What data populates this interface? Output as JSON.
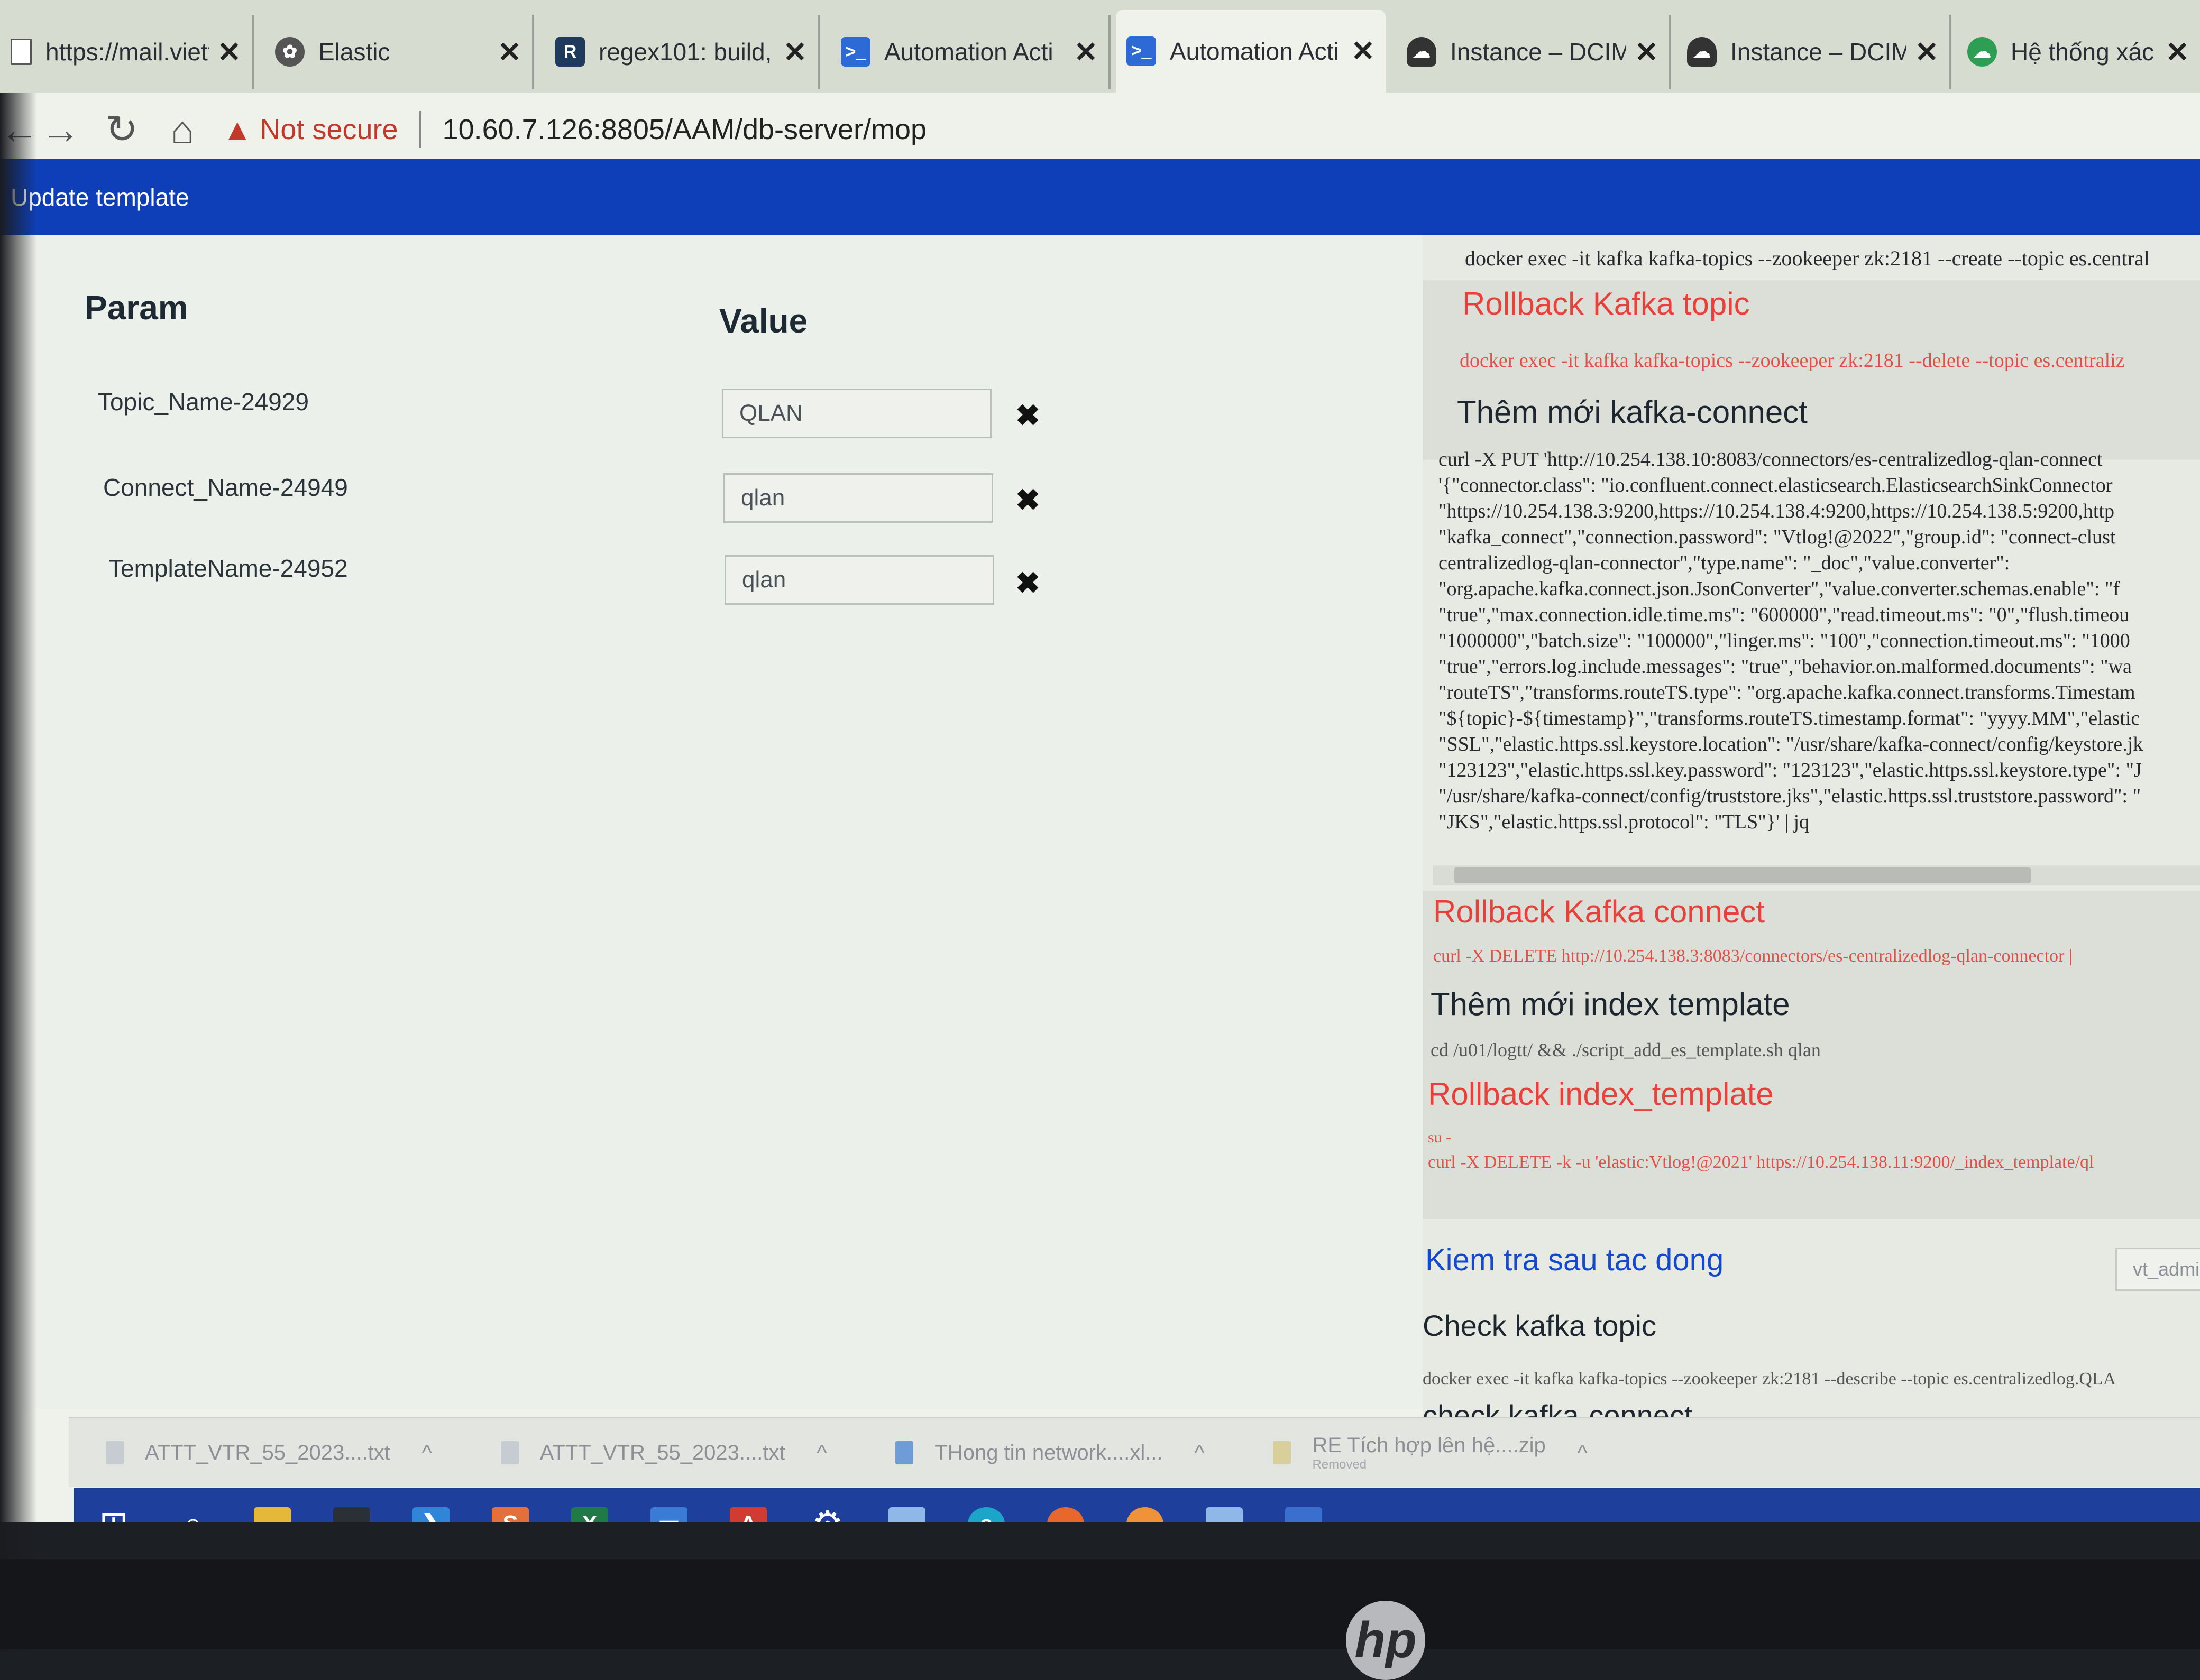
{
  "browser": {
    "tabs": [
      {
        "label": "https://mail.viett",
        "icon": "page-icon"
      },
      {
        "label": "Elastic",
        "icon": "elastic-icon"
      },
      {
        "label": "regex101: build,",
        "icon": "regex101-icon"
      },
      {
        "label": "Automation Acti",
        "icon": "terminal-icon"
      },
      {
        "label": "Automation Acti",
        "icon": "terminal-icon"
      },
      {
        "label": "Instance – DCIM",
        "icon": "cloud-icon"
      },
      {
        "label": "Instance – DCIM",
        "icon": "cloud-icon"
      },
      {
        "label": "Hệ thống xác th",
        "icon": "cloud-green-icon"
      }
    ],
    "security_label": "Not secure",
    "url": "10.60.7.126:8805/AAM/db-server/mop"
  },
  "appbar": {
    "title": "Update template"
  },
  "params": {
    "header_param": "Param",
    "header_value": "Value",
    "rows": [
      {
        "label": "Topic_Name-24929",
        "value": "QLAN"
      },
      {
        "label": "Connect_Name-24949",
        "value": "qlan"
      },
      {
        "label": "TemplateName-24952",
        "value": "qlan"
      }
    ]
  },
  "mop": {
    "create_topic_cmd": "docker exec -it kafka kafka-topics --zookeeper zk:2181 --create --topic es.central",
    "rollback_topic_title": "Rollback Kafka topic",
    "rollback_topic_cmd": "docker exec -it kafka kafka-topics --zookeeper zk:2181 --delete --topic es.centraliz",
    "add_connect_title": "Thêm mới kafka-connect",
    "add_connect_lines": [
      "curl -X PUT 'http://10.254.138.10:8083/connectors/es-centralizedlog-qlan-connect",
      "'{\"connector.class\": \"io.confluent.connect.elasticsearch.ElasticsearchSinkConnector",
      "\"https://10.254.138.3:9200,https://10.254.138.4:9200,https://10.254.138.5:9200,http",
      "\"kafka_connect\",\"connection.password\": \"Vtlog!@2022\",\"group.id\": \"connect-clust",
      "centralizedlog-qlan-connector\",\"type.name\": \"_doc\",\"value.converter\":",
      "\"org.apache.kafka.connect.json.JsonConverter\",\"value.converter.schemas.enable\": \"f",
      "\"true\",\"max.connection.idle.time.ms\": \"600000\",\"read.timeout.ms\": \"0\",\"flush.timeou",
      "\"1000000\",\"batch.size\": \"100000\",\"linger.ms\": \"100\",\"connection.timeout.ms\": \"1000",
      "\"true\",\"errors.log.include.messages\": \"true\",\"behavior.on.malformed.documents\": \"wa",
      "\"routeTS\",\"transforms.routeTS.type\": \"org.apache.kafka.connect.transforms.Timestam",
      "\"${topic}-${timestamp}\",\"transforms.routeTS.timestamp.format\": \"yyyy.MM\",\"elastic",
      "\"SSL\",\"elastic.https.ssl.keystore.location\": \"/usr/share/kafka-connect/config/keystore.jk",
      "\"123123\",\"elastic.https.ssl.key.password\": \"123123\",\"elastic.https.ssl.keystore.type\": \"J",
      "\"/usr/share/kafka-connect/config/truststore.jks\",\"elastic.https.ssl.truststore.password\": \"",
      "\"JKS\",\"elastic.https.ssl.protocol\": \"TLS\"}' | jq"
    ],
    "rollback_connect_title": "Rollback Kafka connect",
    "rollback_connect_cmd": "curl -X DELETE http://10.254.138.3:8083/connectors/es-centralizedlog-qlan-connector |",
    "add_template_title": "Thêm mới index template",
    "add_template_cmd": "cd /u01/logtt/ && ./script_add_es_template.sh qlan",
    "rollback_template_title": "Rollback index_template",
    "rollback_template_su": "su -",
    "rollback_template_cmd": "curl -X DELETE -k -u 'elastic:Vtlog!@2021' https://10.254.138.11:9200/_index_template/ql",
    "verify_title": "Kiem tra sau tac dong",
    "login_value": "vt_admin",
    "check_topic_title": "Check kafka topic",
    "check_topic_cmd": "docker exec -it kafka kafka-topics --zookeeper zk:2181 --describe --topic es.centralizedlog.QLA",
    "check_connect_title": "check kafka-connect"
  },
  "downloads": [
    {
      "name": "ATTT_VTR_55_2023....txt",
      "sub": ""
    },
    {
      "name": "ATTT_VTR_55_2023....txt",
      "sub": ""
    },
    {
      "name": "THong tin network....xl...",
      "sub": ""
    },
    {
      "name": "RE Tích hợp lên hệ....zip",
      "sub": "Removed"
    }
  ],
  "taskbar": {
    "items": [
      "windows-start-icon",
      "search-icon",
      "file-explorer-icon",
      "terminal-app-icon",
      "vscode-icon",
      "sublime-icon",
      "excel-icon",
      "remote-desktop-icon",
      "pdf-icon",
      "settings-icon",
      "notepad-icon",
      "edge-icon",
      "firefox-icon",
      "app-orange-icon",
      "notepad2-icon",
      "network-icon"
    ]
  },
  "colors": {
    "appbar": "#0f3fb8",
    "heading_red": "#e8403a",
    "heading_blue": "#1448d0",
    "taskbar": "#1e3f9c"
  },
  "monitor": {
    "brand": "hp"
  }
}
